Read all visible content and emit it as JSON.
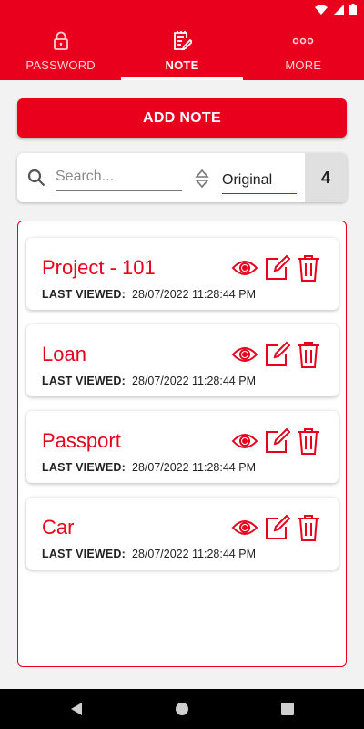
{
  "colors": {
    "accent": "#e8001c",
    "background": "#f2f2f2",
    "card": "#ffffff"
  },
  "tabs": [
    {
      "label": "PASSWORD",
      "icon": "lock-icon",
      "active": false
    },
    {
      "label": "NOTE",
      "icon": "note-edit-icon",
      "active": true
    },
    {
      "label": "MORE",
      "icon": "more-dots-icon",
      "active": false
    }
  ],
  "toolbar": {
    "add_label": "ADD NOTE"
  },
  "search": {
    "placeholder": "Search...",
    "value": ""
  },
  "sort": {
    "selected": "Original"
  },
  "count": "4",
  "notes": [
    {
      "title": "Project - 101",
      "last_viewed_label": "LAST VIEWED:",
      "last_viewed": "28/07/2022 11:28:44 PM"
    },
    {
      "title": "Loan",
      "last_viewed_label": "LAST VIEWED:",
      "last_viewed": "28/07/2022 11:28:44 PM"
    },
    {
      "title": "Passport",
      "last_viewed_label": "LAST VIEWED:",
      "last_viewed": "28/07/2022 11:28:44 PM"
    },
    {
      "title": "Car",
      "last_viewed_label": "LAST VIEWED:",
      "last_viewed": "28/07/2022 11:28:44 PM"
    }
  ]
}
